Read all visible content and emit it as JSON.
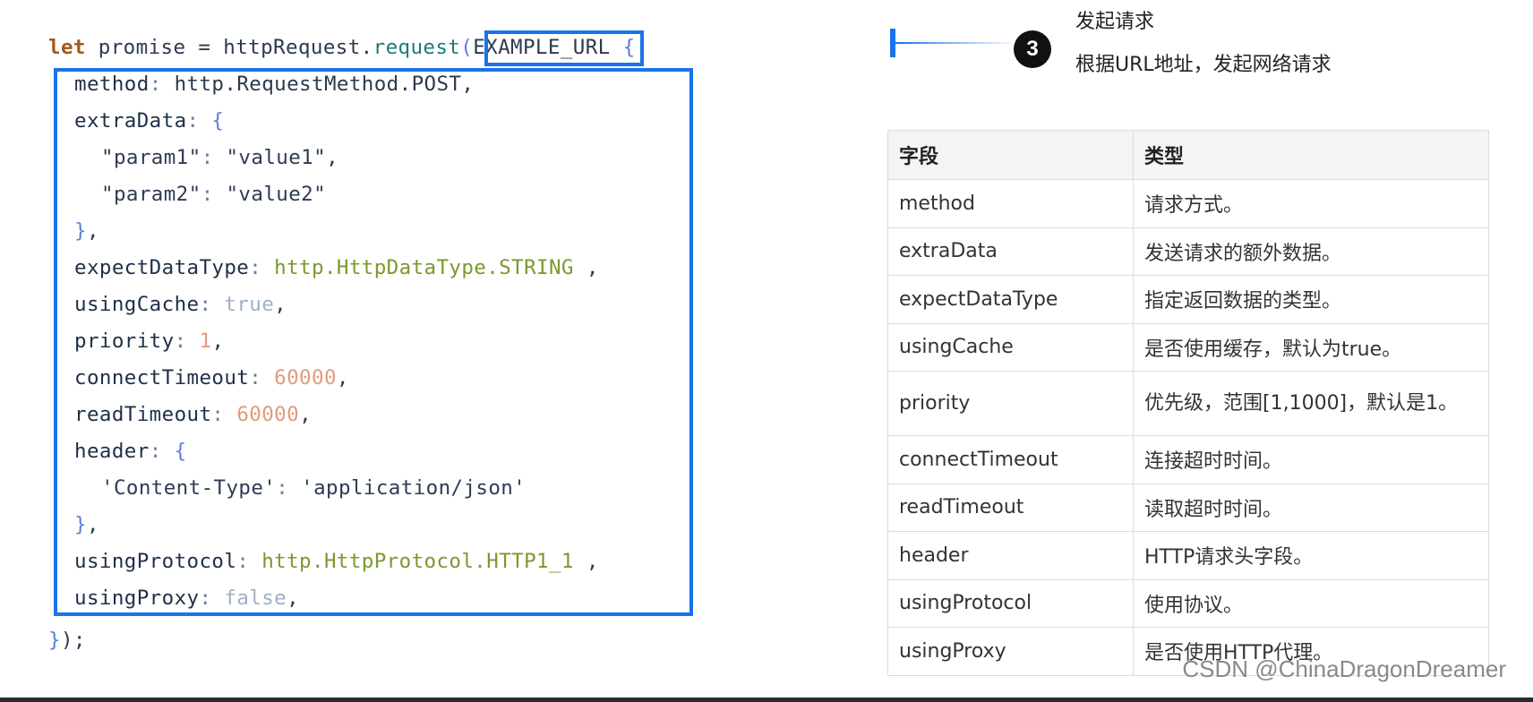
{
  "code": {
    "l1": {
      "kw": "let",
      "var": " promise = ",
      "obj": "httpRequest.",
      "fn": "request",
      "arg": "EXAMPLE_URL",
      "brace": " {"
    },
    "l2": {
      "key": "method",
      "colon": ": ",
      "val": "http.RequestMethod.POST",
      "end": ","
    },
    "l3": {
      "key": "extraData",
      "colon": ": ",
      "brace": "{"
    },
    "l4": {
      "key": "\"param1\"",
      "colon": ": ",
      "val": "\"value1\"",
      "end": ","
    },
    "l5": {
      "key": "\"param2\"",
      "colon": ": ",
      "val": "\"value2\""
    },
    "l6": {
      "brace": "}",
      "end": ","
    },
    "l7": {
      "key": "expectDataType",
      "colon": ": ",
      "val": "http.HttpDataType.STRING",
      "end": " ,"
    },
    "l8": {
      "key": "usingCache",
      "colon": ": ",
      "val": "true",
      "end": ","
    },
    "l9": {
      "key": "priority",
      "colon": ": ",
      "val": "1",
      "end": ","
    },
    "l10": {
      "key": "connectTimeout",
      "colon": ": ",
      "val": "60000",
      "end": ","
    },
    "l11": {
      "key": "readTimeout",
      "colon": ": ",
      "val": "60000",
      "end": ","
    },
    "l12": {
      "key": "header",
      "colon": ": ",
      "brace": "{"
    },
    "l13": {
      "key": "'Content-Type'",
      "colon": ": ",
      "val": "'application/json'"
    },
    "l14": {
      "brace": "}",
      "end": ","
    },
    "l15": {
      "key": "usingProtocol",
      "colon": ": ",
      "val": "http.HttpProtocol.HTTP1_1",
      "end": " ,"
    },
    "l16": {
      "key": "usingProxy",
      "colon": ": ",
      "val": "false",
      "end": ","
    },
    "l17": {
      "brace": "}",
      "end": ");"
    }
  },
  "step": {
    "number": "3",
    "title": "发起请求",
    "desc": "根据URL地址，发起网络请求"
  },
  "table": {
    "headers": [
      "字段",
      "类型"
    ],
    "rows": [
      [
        "method",
        "请求方式。"
      ],
      [
        "extraData",
        "发送请求的额外数据。"
      ],
      [
        "expectDataType",
        "指定返回数据的类型。"
      ],
      [
        "usingCache",
        "是否使用缓存，默认为true。"
      ],
      [
        "priority",
        "优先级，范围[1,1000]，默认是1。"
      ],
      [
        "connectTimeout",
        "连接超时时间。"
      ],
      [
        "readTimeout",
        "读取超时时间。"
      ],
      [
        "header",
        "HTTP请求头字段。"
      ],
      [
        "usingProtocol",
        "使用协议。"
      ],
      [
        "usingProxy",
        "是否使用HTTP代理。"
      ]
    ]
  },
  "watermark": "CSDN @ChinaDragonDreamer",
  "colors": {
    "accent_box": "#1a73e8",
    "badge": "#111111"
  }
}
